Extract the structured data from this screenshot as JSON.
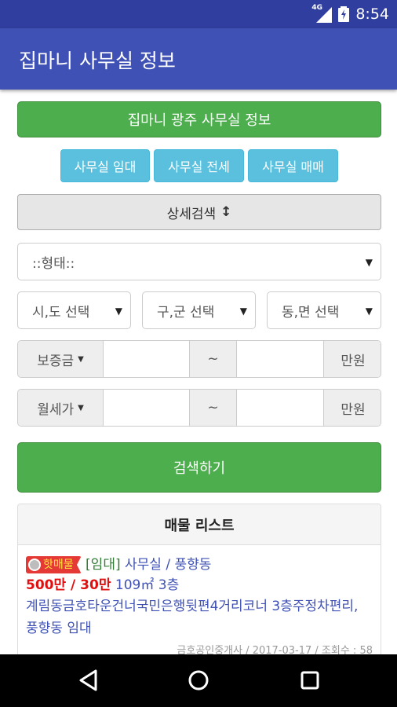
{
  "status": {
    "network": "4G",
    "time": "8:54"
  },
  "appbar": {
    "title": "집마니 사무실 정보"
  },
  "main": {
    "region_button": "집마니 광주 사무실 정보",
    "tabs": [
      "사무실 임대",
      "사무실 전세",
      "사무실 매매"
    ],
    "advanced_search": "상세검색",
    "advanced_icon": "↕",
    "type_select": "::형태::",
    "sido_select": "시,도 선택",
    "gugun_select": "구,군 선택",
    "dong_select": "동,면 선택",
    "deposit": {
      "label": "보증금",
      "tilde": "~",
      "unit": "만원"
    },
    "monthly": {
      "label": "월세가",
      "tilde": "~",
      "unit": "만원"
    },
    "search_button": "검색하기"
  },
  "list": {
    "header": "매물 리스트",
    "items": [
      {
        "badge": "핫매물",
        "tag": "[임대]",
        "category": "사무실 / 풍향동",
        "price": "500만 / 30만",
        "area": "109㎡",
        "floor": "3층",
        "description": "계림동금호타운건너국민은행뒷편4거리코너 3층주정차편리, 풍향동 임대",
        "meta": "금호공인중개사 / 2017-03-17 / 조회수 : 58"
      }
    ]
  },
  "colors": {
    "status_bar": "#303f9f",
    "app_bar": "#3f51b5",
    "green": "#4cae4c",
    "blue": "#5bc0de",
    "price_red": "#e01010"
  }
}
